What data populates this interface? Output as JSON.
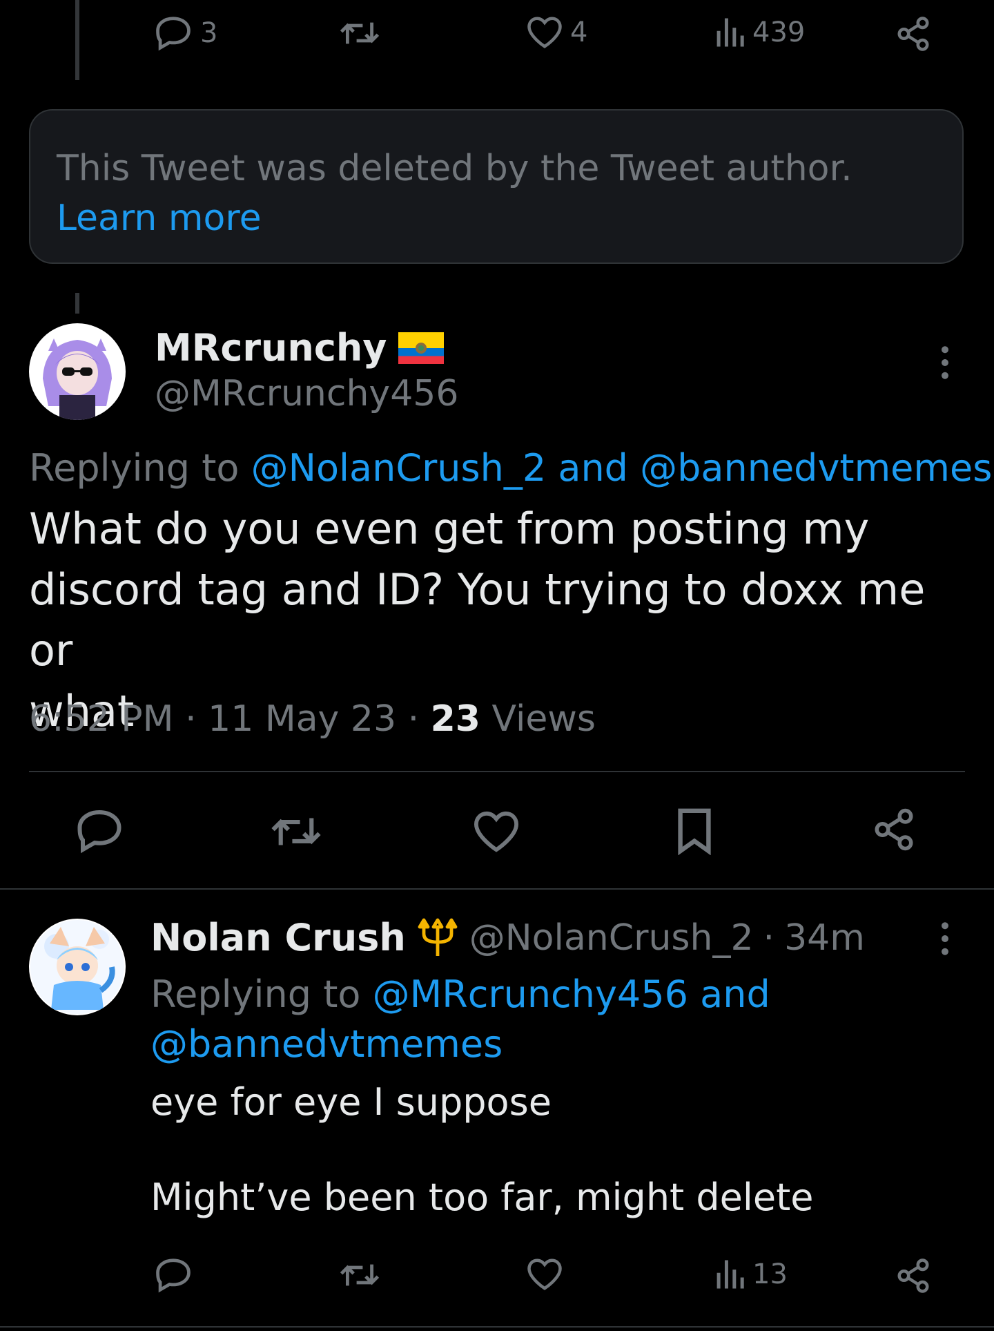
{
  "top_actions": {
    "reply_count": "3",
    "retweet_count": "",
    "like_count": "4",
    "views_count": "439"
  },
  "deleted_notice": {
    "text": "This Tweet was deleted by the Tweet author.",
    "link": "Learn more"
  },
  "main_tweet": {
    "display_name": "MRcrunchy",
    "handle": "@MRcrunchy456",
    "replying_prefix": "Replying to",
    "replying_users": "@NolanCrush_2 and @bannedvtmemes",
    "text_line1": "What do you even get from posting my",
    "text_line2": "discord tag and ID? You trying to doxx me or",
    "text_line3": "what",
    "time": "6:52 PM",
    "date": "11 May 23",
    "views_number": "23",
    "views_label": "Views",
    "flag_colors": [
      "#FFD100",
      "#0072CE",
      "#EF3340"
    ]
  },
  "reply_tweet": {
    "display_name": "Nolan Crush",
    "handle": "@NolanCrush_2",
    "age": "34m",
    "replying_prefix": "Replying to",
    "replying_line1": "@MRcrunchy456 and",
    "replying_line2": "@bannedvtmemes",
    "text_line1": "eye for eye I suppose",
    "text_line2": "Might’ve been too far, might delete",
    "views_count": "13"
  },
  "colors": {
    "background": "#000000",
    "text": "#e7e9ea",
    "muted": "#71767b",
    "link": "#1d9bf0",
    "accent_trident": "#f4b400"
  }
}
